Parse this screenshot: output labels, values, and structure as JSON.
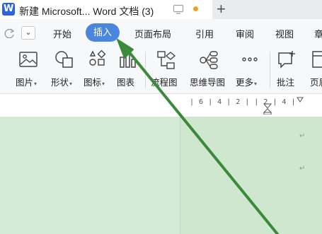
{
  "tabbar": {
    "doc_icon_letter": "W",
    "doc_title": "新建 Microsoft... Word 文档 (3)",
    "new_tab_symbol": "+"
  },
  "menubar": {
    "dropdown_symbol": "⌄",
    "items": [
      {
        "label": "开始",
        "active": false
      },
      {
        "label": "插入",
        "active": true
      },
      {
        "label": "页面布局",
        "active": false
      },
      {
        "label": "引用",
        "active": false
      },
      {
        "label": "审阅",
        "active": false
      },
      {
        "label": "视图",
        "active": false
      },
      {
        "label": "章",
        "active": false
      }
    ]
  },
  "ribbon": {
    "items": [
      {
        "label": "图片",
        "icon": "image-icon",
        "has_dropdown": true
      },
      {
        "label": "形状",
        "icon": "shapes-icon",
        "has_dropdown": true
      },
      {
        "label": "图标",
        "icon": "icons-icon",
        "has_dropdown": true
      },
      {
        "label": "图表",
        "icon": "chart-icon",
        "has_dropdown": false
      },
      {
        "label": "流程图",
        "icon": "flowchart-icon",
        "has_dropdown": false
      },
      {
        "label": "思维导图",
        "icon": "mindmap-icon",
        "has_dropdown": false
      },
      {
        "label": "更多",
        "icon": "more-icon",
        "has_dropdown": true
      },
      {
        "label": "批注",
        "icon": "comment-icon",
        "has_dropdown": false
      },
      {
        "label": "页眉",
        "icon": "header-icon",
        "has_dropdown": false
      }
    ]
  },
  "ruler": {
    "text": "| 6 |  4 |  2 |    | 2 |  4 |"
  },
  "document": {
    "paragraph_mark": "↵"
  },
  "colors": {
    "accent": "#4a86e0",
    "page_background": "#cfe7ce",
    "arrow": "#3a8a3a"
  }
}
